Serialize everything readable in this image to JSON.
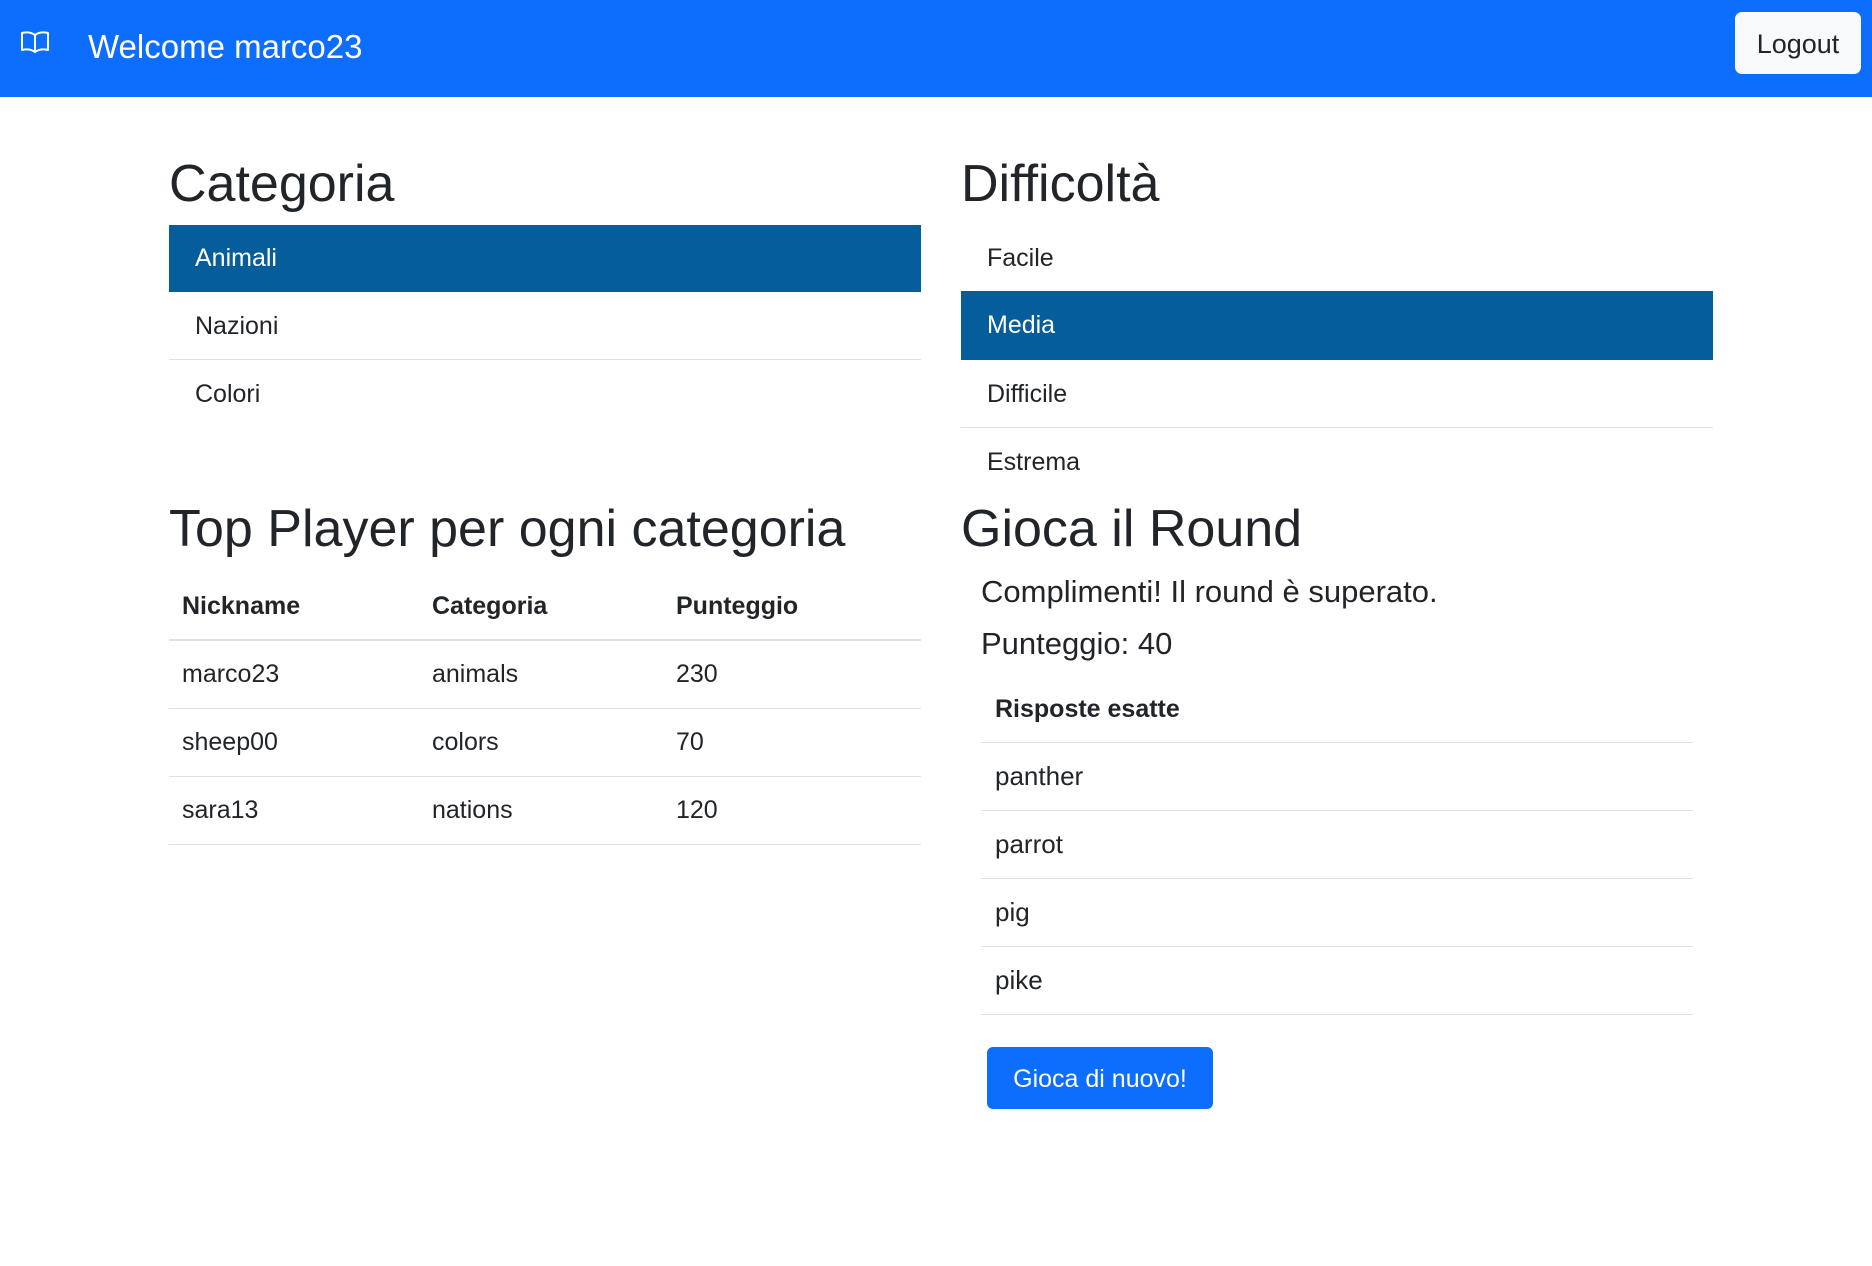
{
  "navbar": {
    "brand_icon": "book-icon",
    "welcome": "Welcome marco23",
    "logout_label": "Logout",
    "color": "#0d6efd"
  },
  "categoria": {
    "title": "Categoria",
    "items": [
      {
        "label": "Animali",
        "active": true
      },
      {
        "label": "Nazioni",
        "active": false
      },
      {
        "label": "Colori",
        "active": false
      }
    ]
  },
  "difficolta": {
    "title": "Difficoltà",
    "items": [
      {
        "label": "Facile",
        "active": false
      },
      {
        "label": "Media",
        "active": true
      },
      {
        "label": "Difficile",
        "active": false
      },
      {
        "label": "Estrema",
        "active": false
      }
    ]
  },
  "top_players": {
    "title": "Top Player per ogni categoria",
    "headers": [
      "Nickname",
      "Categoria",
      "Punteggio"
    ],
    "rows": [
      [
        "marco23",
        "animals",
        "230"
      ],
      [
        "sheep00",
        "colors",
        "70"
      ],
      [
        "sara13",
        "nations",
        "120"
      ]
    ]
  },
  "round": {
    "title": "Gioca il Round",
    "message": "Complimenti! Il round è superato.",
    "score": "Punteggio: 40",
    "answers_header": "Risposte esatte",
    "answers": [
      "panther",
      "parrot",
      "pig",
      "pike"
    ],
    "play_again_label": "Gioca di nuovo!"
  },
  "colors": {
    "active_item": "#055e9b",
    "primary": "#0d6efd"
  }
}
